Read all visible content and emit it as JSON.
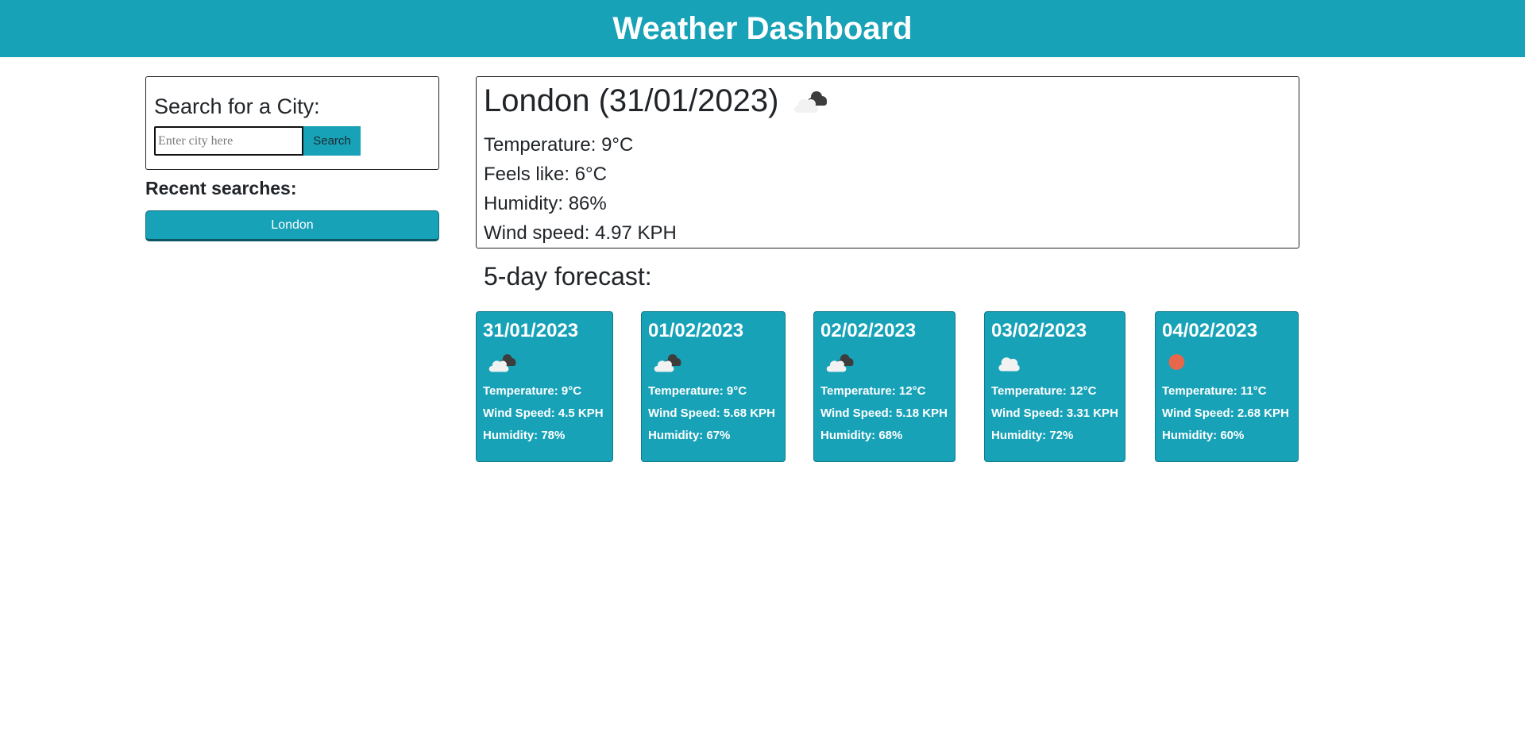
{
  "header": {
    "title": "Weather Dashboard"
  },
  "search": {
    "title": "Search for a City:",
    "placeholder": "Enter city here",
    "value": "",
    "button_label": "Search"
  },
  "recent": {
    "title": "Recent searches:",
    "items": [
      "London"
    ]
  },
  "current": {
    "title": "London (31/01/2023)",
    "icon": "broken-clouds-icon",
    "temperature": "Temperature: 9°C",
    "feels_like": "Feels like: 6°C",
    "humidity": "Humidity: 86%",
    "wind": "Wind speed: 4.97 KPH"
  },
  "forecast": {
    "title": "5-day forecast:",
    "days": [
      {
        "date": "31/01/2023",
        "icon": "broken-clouds-icon",
        "temp": "Temperature: 9°C",
        "wind": "Wind Speed: 4.5 KPH",
        "humidity": "Humidity: 78%"
      },
      {
        "date": "01/02/2023",
        "icon": "broken-clouds-icon",
        "temp": "Temperature: 9°C",
        "wind": "Wind Speed: 5.68 KPH",
        "humidity": "Humidity: 67%"
      },
      {
        "date": "02/02/2023",
        "icon": "broken-clouds-icon",
        "temp": "Temperature: 12°C",
        "wind": "Wind Speed: 5.18 KPH",
        "humidity": "Humidity: 68%"
      },
      {
        "date": "03/02/2023",
        "icon": "cloud-icon",
        "temp": "Temperature: 12°C",
        "wind": "Wind Speed: 3.31 KPH",
        "humidity": "Humidity: 72%"
      },
      {
        "date": "04/02/2023",
        "icon": "sun-icon",
        "temp": "Temperature: 11°C",
        "wind": "Wind Speed: 2.68 KPH",
        "humidity": "Humidity: 60%"
      }
    ]
  },
  "colors": {
    "accent": "#17a2b8",
    "sun": "#e8674a",
    "cloud_light": "#f2f2f2",
    "cloud_dark": "#3d3d3d"
  }
}
